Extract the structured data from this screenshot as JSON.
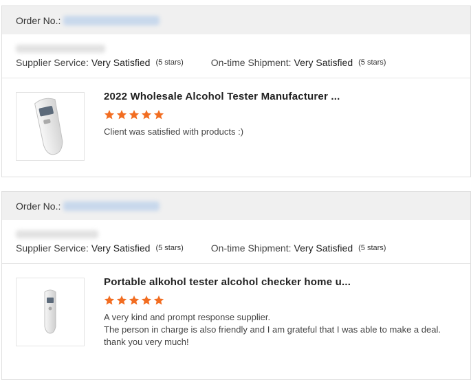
{
  "orders": [
    {
      "order_label": "Order No.:",
      "supplier_service_label": "Supplier Service:",
      "supplier_service_value": "Very Satisfied",
      "supplier_service_stars": "(5 stars)",
      "shipment_label": "On-time Shipment:",
      "shipment_value": "Very Satisfied",
      "shipment_stars": "(5 stars)",
      "product_title": "2022 Wholesale Alcohol Tester Manufacturer ...",
      "rating": 5,
      "comment": [
        "Client was satisfied with products :)"
      ]
    },
    {
      "order_label": "Order No.:",
      "supplier_service_label": "Supplier Service:",
      "supplier_service_value": "Very Satisfied",
      "supplier_service_stars": "(5 stars)",
      "shipment_label": "On-time Shipment:",
      "shipment_value": "Very Satisfied",
      "shipment_stars": "(5 stars)",
      "product_title": "Portable alkohol tester alcohol checker home u...",
      "rating": 5,
      "comment": [
        "A very kind and prompt response supplier.",
        "The person in charge is also friendly and I am grateful that I was able to make a deal.",
        "thank you very much!"
      ]
    }
  ],
  "colors": {
    "star": "#f26d21",
    "header_bg": "#f0f0f0",
    "border": "#dedede"
  },
  "icons": {
    "star": "star-icon",
    "product": "alcohol-tester-product-image"
  }
}
